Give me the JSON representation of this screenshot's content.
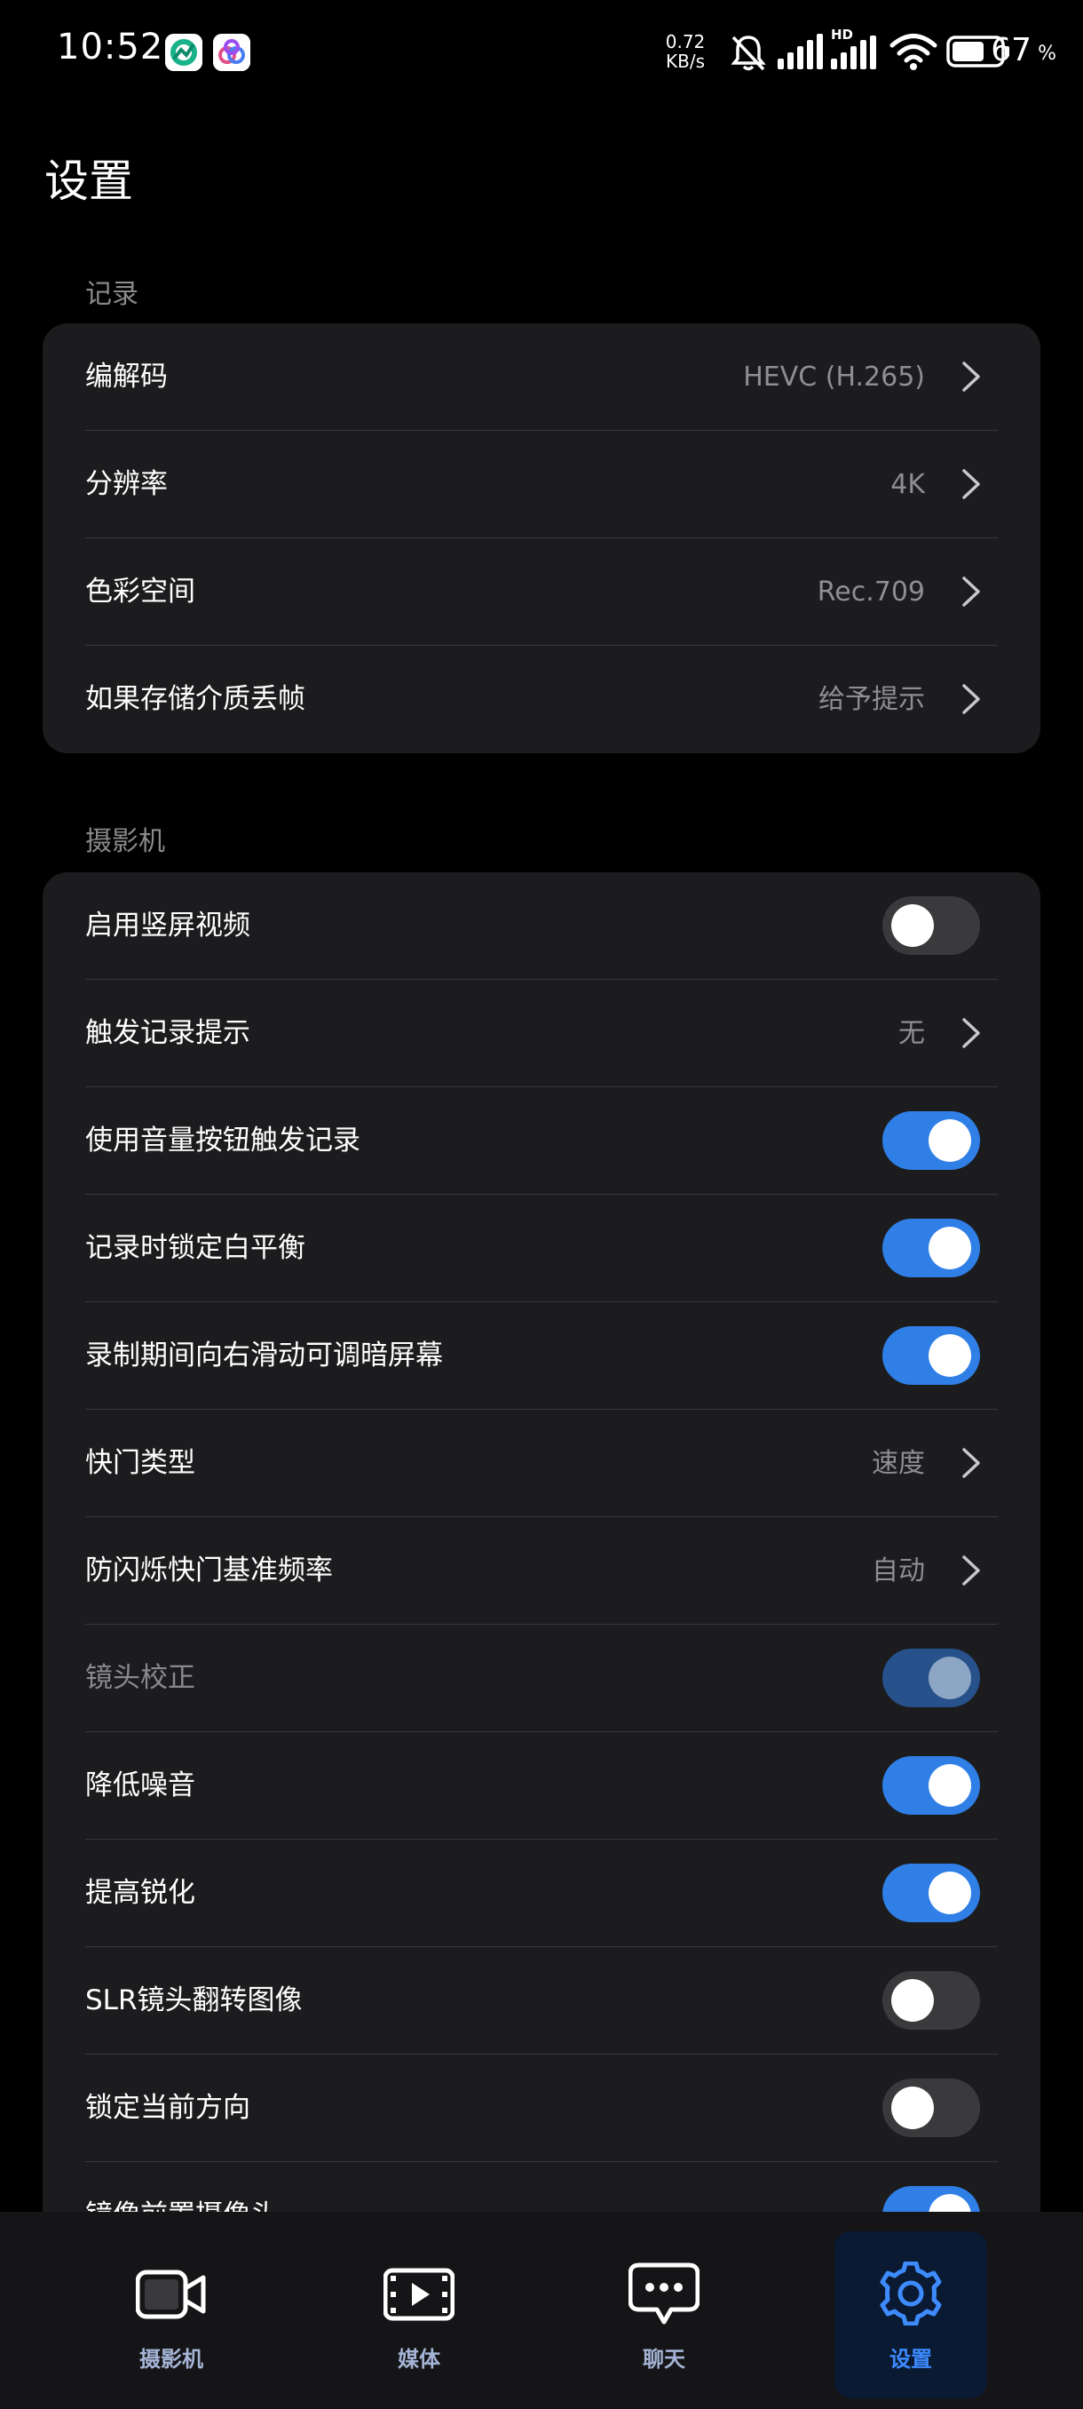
{
  "status_bar": {
    "time": "10:52",
    "net_speed_value": "0.72",
    "net_speed_unit": "KB/s",
    "network_badge": "HD",
    "battery_level": "67",
    "battery_unit": "%",
    "battery_fraction": 0.67
  },
  "page": {
    "title": "设置"
  },
  "sections": [
    {
      "header": "记录",
      "rows": [
        {
          "label": "编解码",
          "value": "HEVC (H.265)"
        },
        {
          "label": "分辨率",
          "value": "4K"
        },
        {
          "label": "色彩空间",
          "value": "Rec.709"
        },
        {
          "label": "如果存储介质丢帧",
          "value": "给予提示"
        }
      ]
    },
    {
      "header": "摄影机",
      "rows": [
        {
          "label": "启用竖屏视频",
          "toggle": false
        },
        {
          "label": "触发记录提示",
          "value": "无"
        },
        {
          "label": "使用音量按钮触发记录",
          "toggle": true
        },
        {
          "label": "记录时锁定白平衡",
          "toggle": true
        },
        {
          "label": "录制期间向右滑动可调暗屏幕",
          "toggle": true
        },
        {
          "label": "快门类型",
          "value": "速度"
        },
        {
          "label": "防闪烁快门基准频率",
          "value": "自动"
        },
        {
          "label": "镜头校正",
          "toggle": true,
          "disabled": true
        },
        {
          "label": "降低噪音",
          "toggle": true
        },
        {
          "label": "提高锐化",
          "toggle": true
        },
        {
          "label": "SLR镜头翻转图像",
          "toggle": false
        },
        {
          "label": "锁定当前方向",
          "toggle": false
        },
        {
          "label": "镜像前置摄像头",
          "toggle": true
        }
      ]
    }
  ],
  "bottom_nav": {
    "items": [
      {
        "label": "摄影机",
        "icon": "video-camera-icon",
        "active": false
      },
      {
        "label": "媒体",
        "icon": "media-play-icon",
        "active": false
      },
      {
        "label": "聊天",
        "icon": "chat-bubble-icon",
        "active": false
      },
      {
        "label": "设置",
        "icon": "gear-icon",
        "active": true
      }
    ]
  },
  "colors": {
    "background": "#000000",
    "card": "#1c1c1e",
    "accent": "#2f7fe6",
    "secondary_text": "#8e8e93"
  }
}
